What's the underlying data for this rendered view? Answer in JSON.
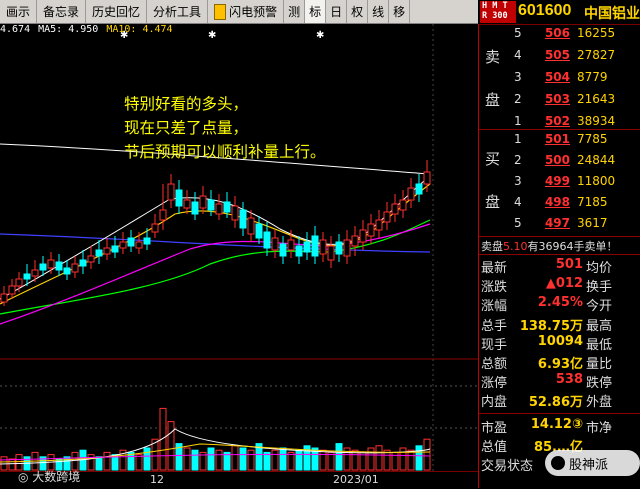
{
  "toolbar": {
    "items": [
      "画示",
      "备忘录",
      "历史回忆",
      "分析工具",
      "闪电预警",
      "测",
      "标",
      "日",
      "权",
      "线",
      "移"
    ],
    "flag_label": "H"
  },
  "header": {
    "hmt_badge": "H M T\nR 300",
    "code": "601600",
    "name": "中国铝业"
  },
  "ma_line": {
    "items": [
      {
        "text": "4.674",
        "color": "#ffffff"
      },
      {
        "text": "MA5: 4.950",
        "color": "#ffffff"
      },
      {
        "text": "MA10: 4.474",
        "color": "#ffd400"
      }
    ]
  },
  "annotation": {
    "line1": "特别好看的多头，",
    "line2": "现在只差了点量，",
    "line3": "节后预期可以顺利补量上行。"
  },
  "order_book": {
    "sell_label_1": "卖",
    "sell_label_2": "盘",
    "buy_label_1": "买",
    "buy_label_2": "盘",
    "sell": [
      {
        "level": "5",
        "price": "506",
        "vol": "16255"
      },
      {
        "level": "4",
        "price": "505",
        "vol": "27827"
      },
      {
        "level": "3",
        "price": "504",
        "vol": "8779"
      },
      {
        "level": "2",
        "price": "503",
        "vol": "21643"
      },
      {
        "level": "1",
        "price": "502",
        "vol": "38934"
      }
    ],
    "buy": [
      {
        "level": "1",
        "price": "501",
        "vol": "7785"
      },
      {
        "level": "2",
        "price": "500",
        "vol": "24844"
      },
      {
        "level": "3",
        "price": "499",
        "vol": "11800"
      },
      {
        "level": "4",
        "price": "498",
        "vol": "7185"
      },
      {
        "level": "5",
        "price": "497",
        "vol": "3617"
      }
    ],
    "sell_message": {
      "prefix": "卖盘",
      "price": "5.10",
      "text": "有36964手卖单！"
    }
  },
  "quote": [
    {
      "k": "最新",
      "v": "501",
      "vcolor": "#ff3030",
      "k2": "均价"
    },
    {
      "k": "涨跌",
      "v": "▲012",
      "vcolor": "#ff3030",
      "k2": "换手"
    },
    {
      "k": "涨幅",
      "v": "2.45%",
      "vcolor": "#ff3030",
      "k2": "今开"
    },
    {
      "k": "总手",
      "v": "138.75万",
      "vcolor": "#ffd400",
      "k2": "最高"
    },
    {
      "k": "现手",
      "v": "10094",
      "vcolor": "#ffd400",
      "k2": "最低"
    },
    {
      "k": "总额",
      "v": "6.93亿",
      "vcolor": "#ffd400",
      "k2": "量比"
    },
    {
      "k": "涨停",
      "v": "538",
      "vcolor": "#ff3030",
      "k2": "跌停"
    },
    {
      "k": "内盘",
      "v": "52.86万",
      "vcolor": "#ffd400",
      "k2": "外盘"
    },
    {
      "k": "市盈",
      "v": "14.12③",
      "vcolor": "#ffd400",
      "k2": "市净"
    },
    {
      "k": "总值",
      "v": "85.…亿",
      "vcolor": "#ffd400",
      "k2": ""
    },
    {
      "k": "交易状态",
      "v": "",
      "vcolor": "#ffd400",
      "k2": ""
    }
  ],
  "quote_right_trunc": [
    "",
    "",
    "",
    "",
    "",
    "",
    "",
    "8",
    "",
    "6",
    ""
  ],
  "xaxis": {
    "labels": [
      "12",
      "2023/01"
    ]
  },
  "watermarks": {
    "left": "大数跨境",
    "right": "股神派"
  },
  "colors": {
    "up": "#ff3030",
    "down": "#00ffff",
    "ma5": "#ffffff",
    "ma10": "#ffd400",
    "ma20": "#ff00ff",
    "ma60": "#00ff00"
  }
}
